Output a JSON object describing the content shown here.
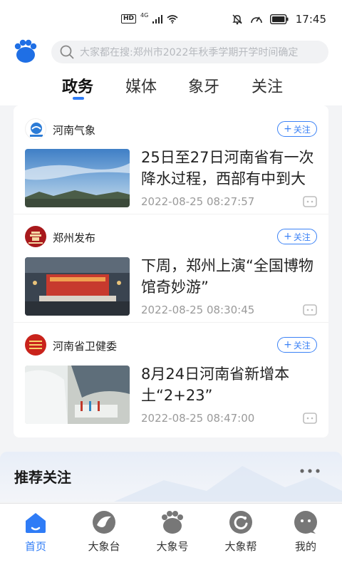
{
  "status_bar": {
    "hd": "HD",
    "network": "4G",
    "time": "17:45"
  },
  "header": {
    "logo_icon": "paw-logo-icon",
    "search": {
      "icon": "search-icon",
      "placeholder": "大家都在搜:郑州市2022年秋季学期开学时间确定"
    }
  },
  "tabs": [
    {
      "label": "政务",
      "active": true
    },
    {
      "label": "媒体",
      "active": false
    },
    {
      "label": "象牙",
      "active": false
    },
    {
      "label": "关注",
      "active": false
    }
  ],
  "feed": [
    {
      "source": "河南气象",
      "follow_label": "关注",
      "headline": "25日至27日河南省有一次降水过程，西部有中到大",
      "time": "2022-08-25 08:27:57"
    },
    {
      "source": "郑州发布",
      "follow_label": "关注",
      "headline": "下周，郑州上演“全国博物馆奇妙游”",
      "time": "2022-08-25 08:30:45"
    },
    {
      "source": "河南省卫健委",
      "follow_label": "关注",
      "headline": "8月24日河南省新增本土“2+23”",
      "time": "2022-08-25 08:47:00"
    }
  ],
  "recommended": {
    "title": "推荐关注"
  },
  "bottom_nav": [
    {
      "label": "首页",
      "icon": "home-icon",
      "active": true
    },
    {
      "label": "大象台",
      "icon": "elephant-tv-icon",
      "active": false
    },
    {
      "label": "大象号",
      "icon": "paw-icon",
      "active": false
    },
    {
      "label": "大象帮",
      "icon": "help-icon",
      "active": false
    },
    {
      "label": "我的",
      "icon": "profile-icon",
      "active": false
    }
  ],
  "colors": {
    "accent": "#2f7cf6",
    "follow_blue": "#3b82f6"
  }
}
